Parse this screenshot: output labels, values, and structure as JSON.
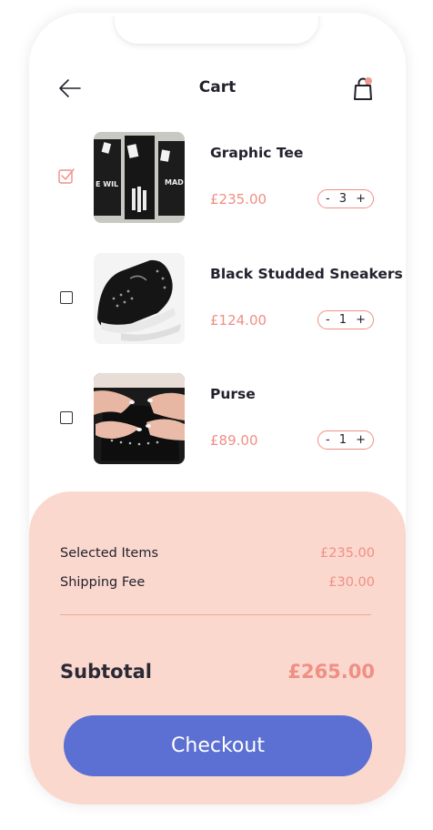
{
  "header": {
    "title": "Cart",
    "back_icon": "arrow-left-icon",
    "bag_icon": "shopping-bag-icon",
    "bag_badge_color": "#f09a8e"
  },
  "items": [
    {
      "name": "Graphic Tee",
      "price": "£235.00",
      "quantity": "3",
      "minus": "-",
      "plus": "+",
      "checked": true
    },
    {
      "name": "Black Studded Sneakers",
      "price": "£124.00",
      "quantity": "1",
      "minus": "-",
      "plus": "+",
      "checked": false
    },
    {
      "name": "Purse",
      "price": "£89.00",
      "quantity": "1",
      "minus": "-",
      "plus": "+",
      "checked": false
    }
  ],
  "summary": {
    "selected_items_label": "Selected Items",
    "selected_items_value": "£235.00",
    "shipping_label": "Shipping Fee",
    "shipping_value": "£30.00",
    "subtotal_label": "Subtotal",
    "subtotal_value": "£265.00",
    "checkout_label": "Checkout"
  },
  "colors": {
    "accent": "#ef8f85",
    "summary_bg": "#fbd8ce",
    "button": "#5b70d2"
  }
}
